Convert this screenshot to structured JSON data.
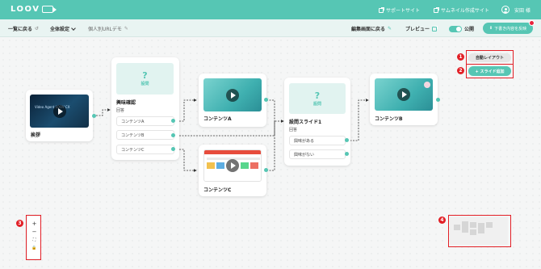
{
  "header": {
    "logo_text": "LOOV",
    "support_link": "サポートサイト",
    "thumbnail_link": "サムネイル作成サイト",
    "user_name": "安田 様"
  },
  "toolbar": {
    "back_to_list": "一覧に戻る",
    "global_settings": "全体設定",
    "demo_name": "個人別URLデモ",
    "back_to_edit": "編集画面に戻る",
    "preview": "プレビュー",
    "publish": "公開",
    "save_changes": "下書き内容を反映"
  },
  "nodes": {
    "greeting": {
      "title": "挨拶",
      "thumb_text": "Video Agent LOOV CX"
    },
    "interest": {
      "question_label": "設問",
      "title": "興味確認",
      "answer_label": "回答",
      "options": [
        "コンテンツA",
        "コンテンツB",
        "コンテンツC"
      ]
    },
    "content_a": {
      "title": "コンテンツA"
    },
    "content_c": {
      "title": "コンテンツC"
    },
    "question1": {
      "question_label": "設問",
      "title": "設問スライド1",
      "answer_label": "回答",
      "options": [
        "興味がある",
        "興味がない"
      ]
    },
    "content_b": {
      "title": "コンテンツB"
    }
  },
  "actions": {
    "auto_layout": "自動レイアウト",
    "add_slide": "+ スライド追加"
  },
  "zoom": {
    "in": "+",
    "out": "−",
    "fit": "⛶",
    "lock": "🔒"
  },
  "badges": [
    "1",
    "2",
    "3",
    "4"
  ],
  "colors": {
    "accent": "#56c6b4",
    "annotation_red": "#e21f26"
  }
}
